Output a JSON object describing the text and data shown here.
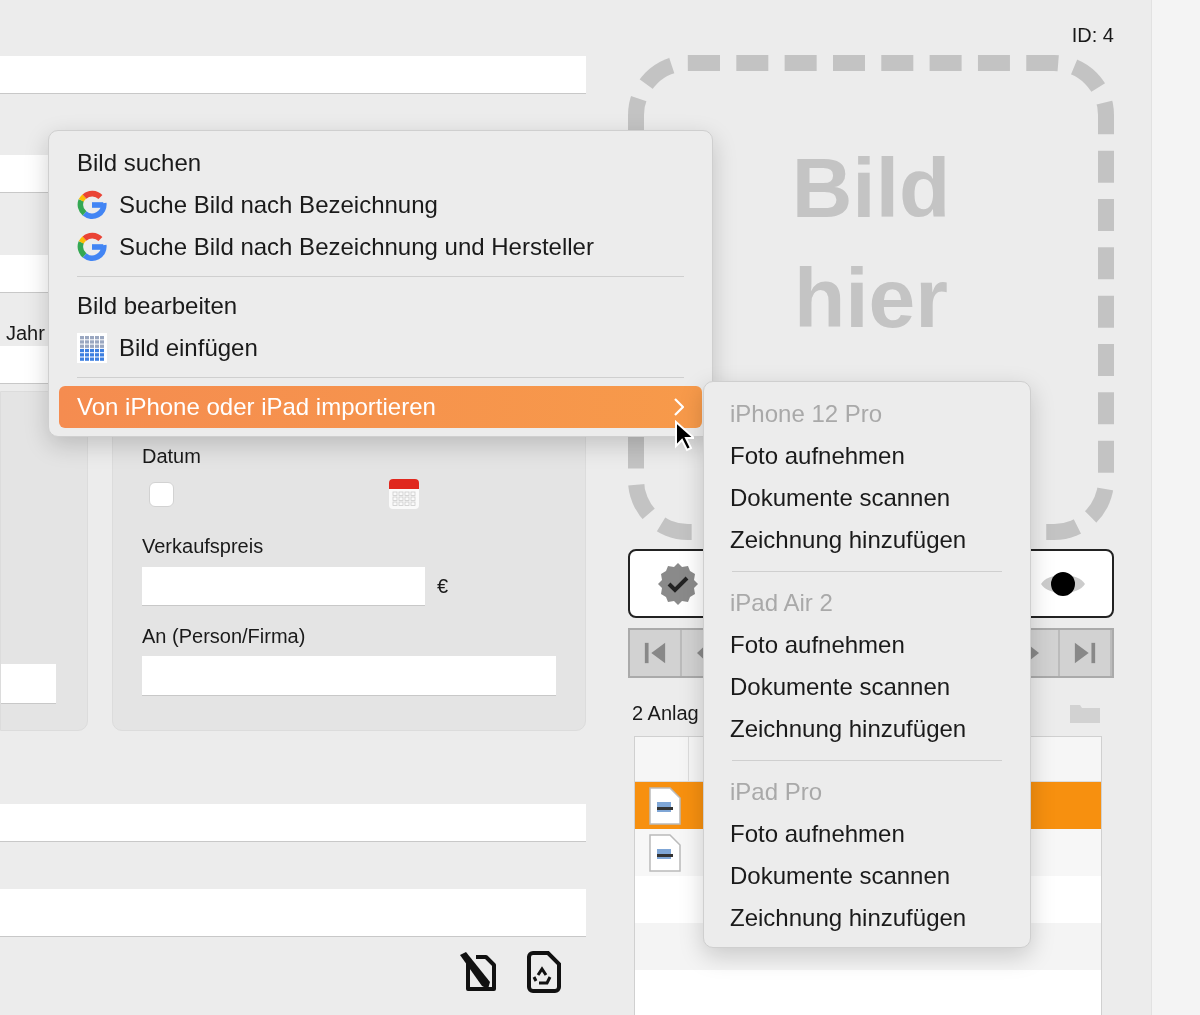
{
  "id_label": "ID: 4",
  "form": {
    "year_label": "Jahr"
  },
  "drop_zone": {
    "lines": [
      "Bild",
      "hier"
    ]
  },
  "sale": {
    "date_label": "Datum",
    "date_checked": false,
    "price_label": "Verkaufspreis",
    "currency": "€",
    "buyer_label": "An (Person/Firma)"
  },
  "attachments": {
    "count_label": "2 Anlag",
    "rows": [
      {
        "selected": true
      },
      {
        "selected": false
      }
    ]
  },
  "context_menu": {
    "items": [
      {
        "kind": "header",
        "label": "Bild suchen",
        "separator_before": false,
        "selected": false
      },
      {
        "kind": "google",
        "label": "Suche Bild nach Bezeichnung",
        "separator_before": false,
        "selected": false
      },
      {
        "kind": "google",
        "label": "Suche Bild nach Bezeichnung und Hersteller",
        "separator_before": false,
        "selected": false
      },
      {
        "kind": "header",
        "label": "Bild bearbeiten",
        "separator_before": true,
        "selected": false
      },
      {
        "kind": "paste",
        "label": "Bild einfügen",
        "separator_before": false,
        "selected": false
      },
      {
        "kind": "submenu",
        "label": "Von iPhone oder iPad importieren",
        "separator_before": true,
        "selected": true
      }
    ]
  },
  "submenu": {
    "sections": [
      {
        "device": "iPhone 12 Pro",
        "items": [
          "Foto aufnehmen",
          "Dokumente scannen",
          "Zeichnung hinzufügen"
        ]
      },
      {
        "device": "iPad Air 2",
        "items": [
          "Foto aufnehmen",
          "Dokumente scannen",
          "Zeichnung hinzufügen"
        ]
      },
      {
        "device": "iPad Pro",
        "items": [
          "Foto aufnehmen",
          "Dokumente scannen",
          "Zeichnung hinzufügen"
        ]
      }
    ]
  }
}
